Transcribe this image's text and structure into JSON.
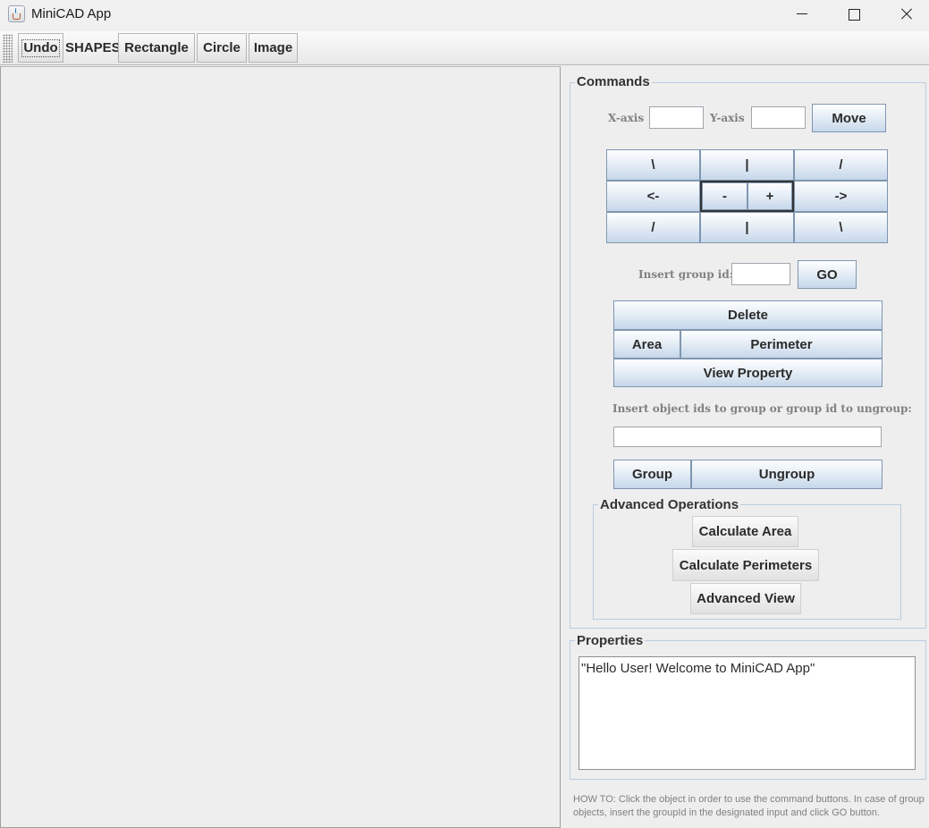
{
  "window": {
    "title": "MiniCAD App",
    "icon": "java-cup-icon"
  },
  "toolbar": {
    "undo": "Undo",
    "shapes_label": "SHAPES",
    "rectangle": "Rectangle",
    "circle": "Circle",
    "image": "Image"
  },
  "commands": {
    "title": "Commands",
    "x_label": "X-axis",
    "x_value": "",
    "y_label": "Y-axis",
    "y_value": "",
    "move": "Move",
    "pad": {
      "up_left": "\\",
      "up": "|",
      "up_right": "/",
      "left": "<-",
      "zoom_out": "-",
      "zoom_in": "+",
      "right": "->",
      "down_left": "/",
      "down": "|",
      "down_right": "\\"
    },
    "group_id_label": "Insert group id:",
    "group_id_value": "",
    "go": "GO",
    "delete": "Delete",
    "area": "Area",
    "perimeter": "Perimeter",
    "view_property": "View Property",
    "ids_label": "Insert object ids to group or group id to ungroup:",
    "ids_value": "",
    "group": "Group",
    "ungroup": "Ungroup"
  },
  "advanced": {
    "title": "Advanced Operations",
    "calc_area": "Calculate Area",
    "calc_perimeters": "Calculate Perimeters",
    "advanced_view": "Advanced View"
  },
  "properties": {
    "title": "Properties",
    "text": "\"Hello User! Welcome to MiniCAD App\""
  },
  "howto": "HOW TO: Click the object in order to use the command buttons. In case of group objects, insert the groupId in the designated input and click GO button."
}
